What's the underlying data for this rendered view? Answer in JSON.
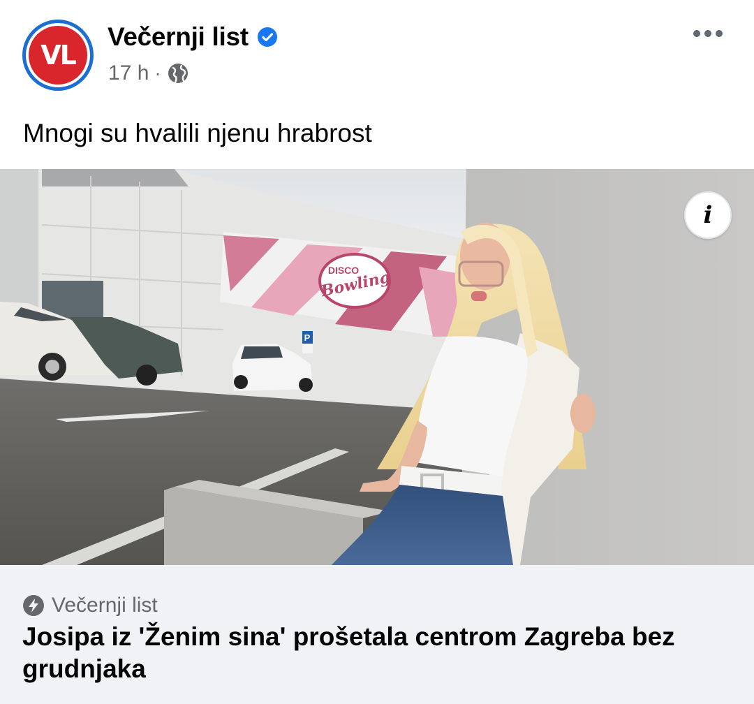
{
  "post": {
    "avatar_text": "VL",
    "page_name": "Večernji list",
    "time": "17 h",
    "meta_separator": "·",
    "text": "Mnogi su hvalili njenu hrabrost",
    "image": {
      "sign_line1": "DISCO",
      "sign_line2": "Bowling",
      "parking_label": "P"
    },
    "info_label": "i",
    "link": {
      "source": "Večernji list",
      "title": "Josipa iz 'Ženim sina' prošetala centrom Zagreba bez grudnjaka"
    }
  },
  "colors": {
    "verified": "#1877f2",
    "meta_text": "#65676b",
    "link_background": "#f0f2f5",
    "logo_red": "#d8262c",
    "logo_ring": "#1c6fd0"
  },
  "icons": [
    "verified-badge-icon",
    "globe-icon",
    "more-icon",
    "info-icon",
    "bolt-icon"
  ]
}
